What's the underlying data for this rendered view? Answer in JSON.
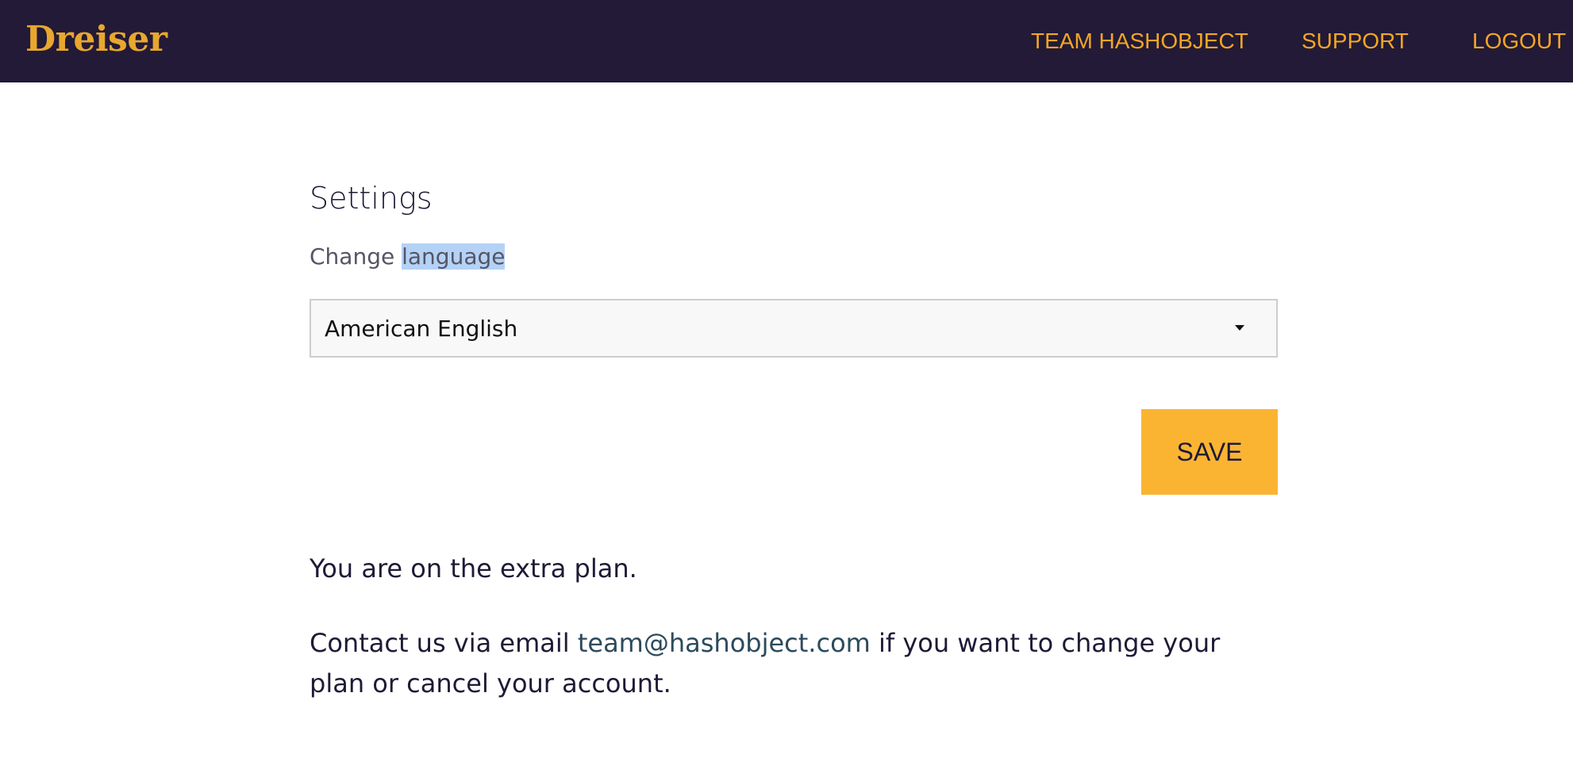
{
  "header": {
    "brand": "Dreiser",
    "nav": {
      "team": "TEAM HASHOBJECT",
      "support": "SUPPORT",
      "logout": "LOGOUT"
    }
  },
  "settings": {
    "title": "Settings",
    "change_prefix": "Change ",
    "change_highlighted": "language",
    "language_select": {
      "selected": "American English"
    },
    "save_label": "SAVE"
  },
  "plan": {
    "text": "You are on the extra plan.",
    "contact_before": "Contact us via email ",
    "email": "team@hashobject.com",
    "contact_after": " if you want to change your plan or cancel your account."
  },
  "colors": {
    "header_bg": "#221a37",
    "brand": "#e8a72e",
    "nav_text": "#f5a623",
    "save_button": "#fbb432",
    "selection_highlight": "#b4d2f5"
  }
}
